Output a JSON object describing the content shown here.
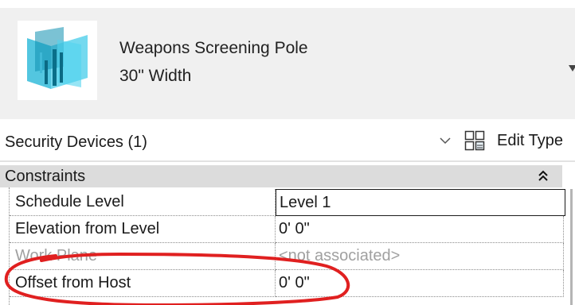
{
  "type_selector": {
    "family": "Weapons Screening Pole",
    "type": "30\" Width",
    "thumbnail_icon": "weapons-screening-pole-thumbnail",
    "dropdown_icon": "triangle-down-icon"
  },
  "filter": {
    "category": "Security Devices (1)",
    "dropdown_icon": "chevron-down-icon",
    "edit_type_label": "Edit Type",
    "edit_type_icon": "edit-type-icon"
  },
  "properties": {
    "group": {
      "label": "Constraints",
      "collapse_icon": "double-chevron-up-icon",
      "collapse_glyph": "⌃"
    },
    "rows": [
      {
        "name": "Schedule Level",
        "value": "Level 1",
        "editing": true,
        "disabled": false
      },
      {
        "name": "Elevation from Level",
        "value": "0'  0\"",
        "editing": false,
        "disabled": false
      },
      {
        "name": "Work Plane",
        "value": "<not associated>",
        "editing": false,
        "disabled": true
      },
      {
        "name": "Offset from Host",
        "value": "0'  0\"",
        "editing": false,
        "disabled": false
      }
    ]
  },
  "colors": {
    "header_bg": "#f0f0f0",
    "group_bg": "#dcdcdc",
    "disabled_text": "#a0a0a0",
    "annotation": "#e02020",
    "icon_cyan": "#1ab3d6"
  }
}
